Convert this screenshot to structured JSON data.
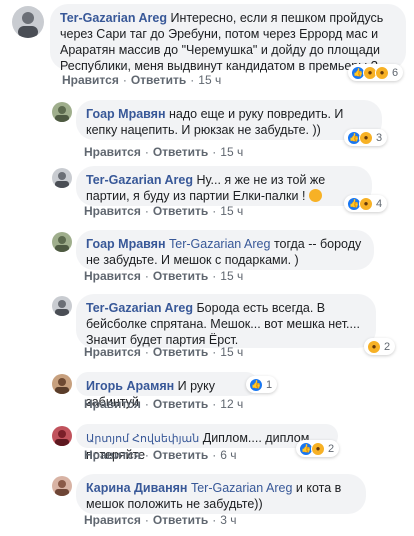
{
  "comments": [
    {
      "author": "Ter-Gazarian Areg",
      "mention": "",
      "text": "Интересно, если я пешком пройдусь через Сари таг до Эребуни, потом через Еррорд мас и Араратян массив до \"Черемушка\" и дойду до площади Республики, меня выдвинут кандидатом в премьеры ?",
      "like": "Нравится",
      "reply": "Ответить",
      "time": "15 ч",
      "reaction_count": "6",
      "avatar_color": "#8a8f99"
    },
    {
      "author": "Гоар Мравян",
      "mention": "",
      "text": "надо еще и руку повредить. И кепку нацепить. И рюкзак не забудьте. ))",
      "like": "Нравится",
      "reply": "Ответить",
      "time": "15 ч",
      "reaction_count": "3",
      "avatar_color": "#7a8b6e"
    },
    {
      "author": "Ter-Gazarian Areg",
      "mention": "",
      "text": "Ну... я же не из той же партии, я буду из партии Елки-палки !",
      "like": "Нравится",
      "reply": "Ответить",
      "time": "15 ч",
      "reaction_count": "4",
      "avatar_color": "#8a8f99"
    },
    {
      "author": "Гоар Мравян",
      "mention": "Ter-Gazarian Areg",
      "text": "тогда -- бороду не забудьте. И мешок с подарками. )",
      "like": "Нравится",
      "reply": "Ответить",
      "time": "15 ч",
      "reaction_count": "",
      "avatar_color": "#7a8b6e"
    },
    {
      "author": "Ter-Gazarian Areg",
      "mention": "",
      "text": "Борода есть всегда. В бейсболке спрятана. Мешок... вот мешка нет.... Значит будет партия Ёрст.",
      "like": "Нравится",
      "reply": "Ответить",
      "time": "15 ч",
      "reaction_count": "2",
      "avatar_color": "#8a8f99"
    },
    {
      "author": "Игорь Арамян",
      "mention": "",
      "text": "И руку забинтуй",
      "like": "Нравится",
      "reply": "Ответить",
      "time": "12 ч",
      "reaction_count": "1",
      "avatar_color": "#a0755a"
    },
    {
      "author": "Արտյոմ Հովսեփյան",
      "mention": "",
      "text": "Диплом.... диплом потеряйте",
      "like": "Нравится",
      "reply": "Ответить",
      "time": "6 ч",
      "reaction_count": "2",
      "avatar_color": "#9b2f3a"
    },
    {
      "author": "Карина Диванян",
      "mention": "Ter-Gazarian Areg",
      "text": "и кота в мешок положить не забудьте))",
      "like": "Нравится",
      "reply": "Ответить",
      "time": "3 ч",
      "reaction_count": "",
      "avatar_color": "#b58b7a"
    }
  ]
}
